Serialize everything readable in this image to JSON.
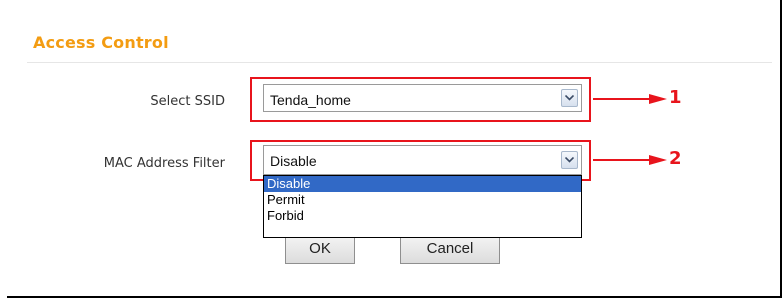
{
  "section": {
    "title": "Access Control"
  },
  "ssid": {
    "label": "Select SSID",
    "value": "Tenda_home"
  },
  "mac_filter": {
    "label": "MAC Address Filter",
    "value": "Disable",
    "options": [
      "Disable",
      "Permit",
      "Forbid"
    ],
    "selected_option": "Disable"
  },
  "buttons": {
    "ok": "OK",
    "cancel": "Cancel"
  },
  "annotations": {
    "one": "1",
    "two": "2"
  },
  "colors": {
    "title": "#f39c12",
    "highlight": "#e8141c",
    "selection": "#3169c6"
  },
  "icons": {
    "dropdown_arrow": "chevron-down-icon",
    "callout_arrow": "arrow-left-icon"
  }
}
